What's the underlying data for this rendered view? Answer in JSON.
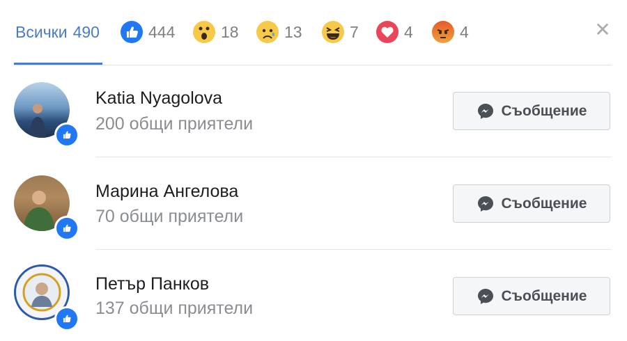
{
  "tabs": {
    "all_label": "Всички",
    "all_count": "490",
    "reactions": [
      {
        "name": "like",
        "count": "444"
      },
      {
        "name": "wow",
        "count": "18"
      },
      {
        "name": "sad",
        "count": "13"
      },
      {
        "name": "haha",
        "count": "7"
      },
      {
        "name": "love",
        "count": "4"
      },
      {
        "name": "angry",
        "count": "4"
      }
    ]
  },
  "close_icon": "close-icon",
  "people": [
    {
      "name": "Katia Nyagolova",
      "mutual": "200 общи приятели",
      "button": "Съобщение"
    },
    {
      "name": "Марина Ангелова",
      "mutual": "70 общи приятели",
      "button": "Съобщение"
    },
    {
      "name": "Петър Панков",
      "mutual": "137 общи приятели",
      "button": "Съобщение"
    }
  ],
  "colors": {
    "accent": "#4a7bc8",
    "like": "#2078f4",
    "love": "#e9465a",
    "yellow": "#f7c948"
  }
}
